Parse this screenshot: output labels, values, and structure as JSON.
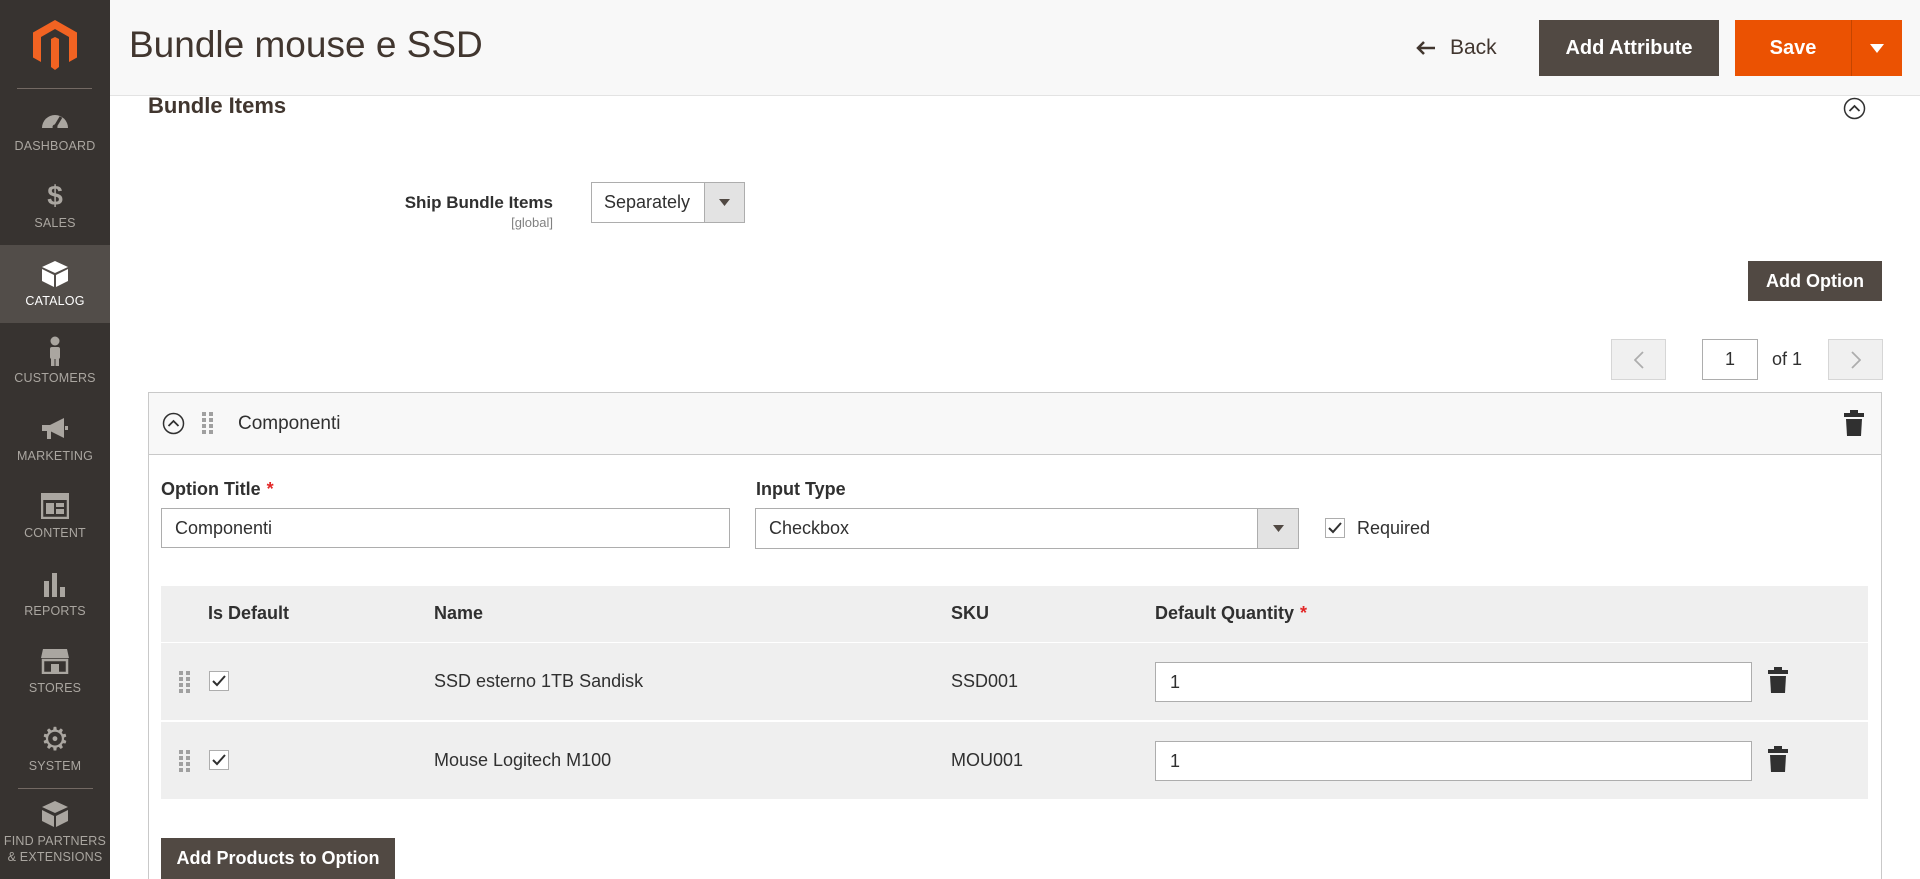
{
  "sidebar": {
    "items": [
      {
        "label": "DASHBOARD",
        "icon": "dashboard-icon"
      },
      {
        "label": "SALES",
        "icon": "dollar-icon"
      },
      {
        "label": "CATALOG",
        "icon": "box-icon",
        "active": true
      },
      {
        "label": "CUSTOMERS",
        "icon": "person-icon"
      },
      {
        "label": "MARKETING",
        "icon": "megaphone-icon"
      },
      {
        "label": "CONTENT",
        "icon": "layout-icon"
      },
      {
        "label": "REPORTS",
        "icon": "bar-chart-icon"
      },
      {
        "label": "STORES",
        "icon": "store-icon"
      },
      {
        "label": "SYSTEM",
        "icon": "gear-icon"
      }
    ],
    "partners_line1": "FIND PARTNERS",
    "partners_line2": "& EXTENSIONS"
  },
  "header": {
    "title": "Bundle mouse e SSD",
    "back_label": "Back",
    "add_attribute_label": "Add Attribute",
    "save_label": "Save"
  },
  "bundle": {
    "section_title": "Bundle Items",
    "ship_label": "Ship Bundle Items",
    "ship_scope": "[global]",
    "ship_value": "Separately",
    "add_option_label": "Add Option",
    "pager": {
      "current": "1",
      "of_label": "of 1"
    }
  },
  "option": {
    "header_title": "Componenti",
    "title_label": "Option Title",
    "title_value": "Componenti",
    "input_type_label": "Input Type",
    "input_type_value": "Checkbox",
    "required_label": "Required",
    "required_checked": true,
    "columns": {
      "is_default": "Is Default",
      "name": "Name",
      "sku": "SKU",
      "default_qty": "Default Quantity"
    },
    "rows": [
      {
        "is_default": true,
        "name": "SSD esterno 1TB Sandisk",
        "sku": "SSD001",
        "qty": "1"
      },
      {
        "is_default": true,
        "name": "Mouse Logitech M100",
        "sku": "MOU001",
        "qty": "1"
      }
    ],
    "add_products_label": "Add Products to Option"
  },
  "colors": {
    "sidebar_bg": "#373330",
    "accent": "#eb5202",
    "dark_button": "#514943",
    "required_star": "#e22626"
  }
}
